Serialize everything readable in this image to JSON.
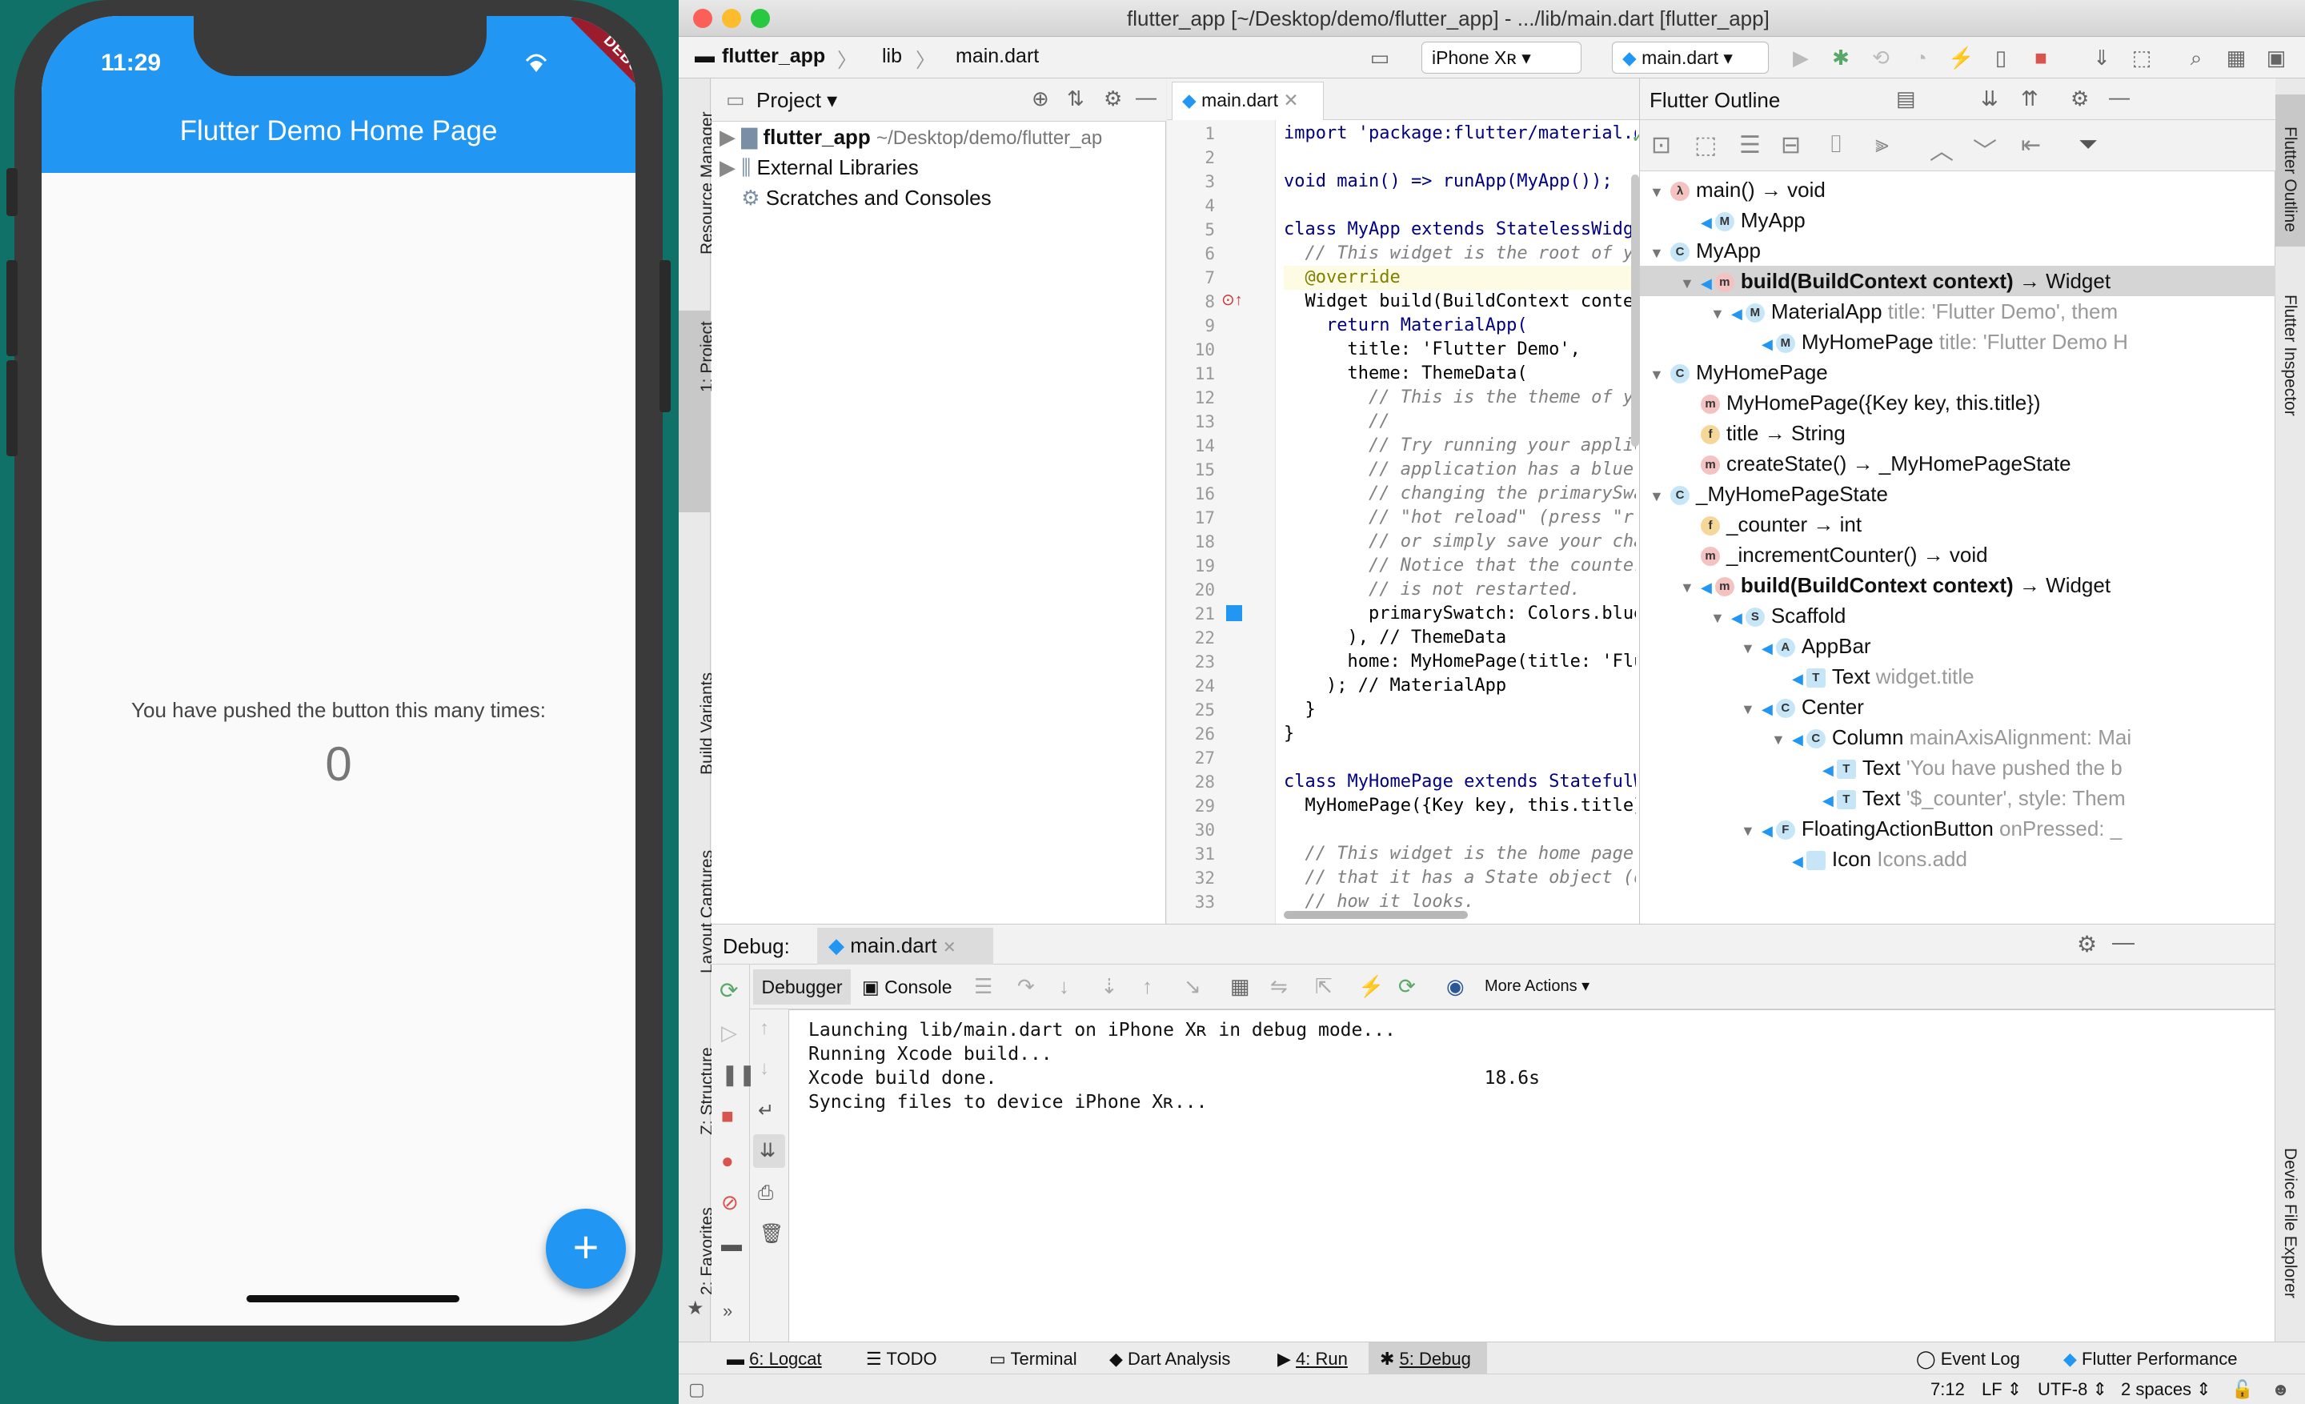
{
  "phone": {
    "time": "11:29",
    "debug_banner": "DEBUG",
    "app_title": "Flutter Demo Home Page",
    "counter_label": "You have pushed the button this many times:",
    "counter_value": "0",
    "fab_icon": "plus-icon",
    "fab_label": "+"
  },
  "window": {
    "title": "flutter_app [~/Desktop/demo/flutter_app] - .../lib/main.dart [flutter_app]"
  },
  "breadcrumbs": [
    "flutter_app",
    "lib",
    "main.dart"
  ],
  "toolbar": {
    "device": "iPhone Xʀ",
    "run_config": "main.dart"
  },
  "left_tools": [
    "Resource Manager",
    "1: Project",
    "Build Variants",
    "Layout Captures",
    "Z: Structure",
    "2: Favorites"
  ],
  "right_tools": [
    "Flutter Outline",
    "Flutter Inspector",
    "Device File Explorer"
  ],
  "project": {
    "header": "Project",
    "items": [
      {
        "label": "flutter_app",
        "path": "~/Desktop/demo/flutter_ap"
      },
      {
        "label": "External Libraries"
      },
      {
        "label": "Scratches and Consoles"
      }
    ]
  },
  "editor": {
    "tab": "main.dart",
    "lines": [
      "import 'package:flutter/material.dart';",
      "",
      "void main() => runApp(MyApp());",
      "",
      "class MyApp extends StatelessWidget {",
      "  // This widget is the root of your application.",
      "  @override",
      "  Widget build(BuildContext context) {",
      "    return MaterialApp(",
      "      title: 'Flutter Demo',",
      "      theme: ThemeData(",
      "        // This is the theme of your application.",
      "        //",
      "        // Try running your application with \"flutter run\". You'll see the",
      "        // application has a blue toolbar. Then, without quitting the app, try",
      "        // changing the primarySwatch below to Colors.green and then invoke",
      "        // \"hot reload\" (press \"r\" in the console where you ran \"flutter run\",",
      "        // or simply save your changes to \"hot reload\" in a Flutter IDE).",
      "        // Notice that the counter didn't reset back to zero; the application",
      "        // is not restarted.",
      "        primarySwatch: Colors.blue,",
      "      ), // ThemeData",
      "      home: MyHomePage(title: 'Flutter Demo Home Page'),",
      "    ); // MaterialApp",
      "  }",
      "}",
      "",
      "class MyHomePage extends StatefulWidget {",
      "  MyHomePage({Key key, this.title}) : super(key: key);",
      "",
      "  // This widget is the home page of your application. It is stateful, meaning",
      "  // that it has a State object (defined below) that contains fields that affect",
      "  // how it looks."
    ]
  },
  "outline": {
    "title": "Flutter Outline",
    "rows": [
      {
        "badge": "λ",
        "name": "main() → void",
        "extra": ""
      },
      {
        "badge": "M",
        "name": "MyApp",
        "extra": ""
      },
      {
        "badge": "C",
        "name": "MyApp",
        "extra": ""
      },
      {
        "badge": "m",
        "name": "build(BuildContext context)",
        "extra": " → Widget"
      },
      {
        "badge": "M",
        "name": "MaterialApp",
        "extra": " title: 'Flutter Demo', them"
      },
      {
        "badge": "M",
        "name": "MyHomePage",
        "extra": " title: 'Flutter Demo H"
      },
      {
        "badge": "C",
        "name": "MyHomePage",
        "extra": ""
      },
      {
        "badge": "m",
        "name": "MyHomePage({Key key, this.title})",
        "extra": ""
      },
      {
        "badge": "f",
        "name": "title → String",
        "extra": ""
      },
      {
        "badge": "m",
        "name": "createState() → _MyHomePageState",
        "extra": ""
      },
      {
        "badge": "C",
        "name": "_MyHomePageState",
        "extra": ""
      },
      {
        "badge": "f",
        "name": "_counter → int",
        "extra": ""
      },
      {
        "badge": "m",
        "name": "_incrementCounter() → void",
        "extra": ""
      },
      {
        "badge": "m",
        "name": "build(BuildContext context)",
        "extra": " → Widget"
      },
      {
        "badge": "S",
        "name": "Scaffold",
        "extra": ""
      },
      {
        "badge": "A",
        "name": "AppBar",
        "extra": ""
      },
      {
        "badge": "T",
        "name": "Text",
        "extra": " widget.title"
      },
      {
        "badge": "C",
        "name": "Center",
        "extra": ""
      },
      {
        "badge": "C",
        "name": "Column",
        "extra": " mainAxisAlignment: Mai"
      },
      {
        "badge": "T",
        "name": "Text",
        "extra": " 'You have pushed the b"
      },
      {
        "badge": "T",
        "name": "Text",
        "extra": " '$_counter', style: Them"
      },
      {
        "badge": "F",
        "name": "FloatingActionButton",
        "extra": " onPressed: _"
      },
      {
        "badge": "",
        "name": "Icon",
        "extra": " Icons.add"
      }
    ]
  },
  "debug": {
    "label": "Debug:",
    "tab": "main.dart",
    "debugger_tab": "Debugger",
    "console_tab": "Console",
    "more_actions": "More Actions",
    "console_lines": [
      "Launching lib/main.dart on iPhone Xʀ in debug mode...",
      "Running Xcode build...",
      "Xcode build done.                                            18.6s",
      "Syncing files to device iPhone Xʀ..."
    ]
  },
  "bottom_tabs": [
    "6: Logcat",
    "TODO",
    "Terminal",
    "Dart Analysis",
    "4: Run",
    "5: Debug",
    "Event Log",
    "Flutter Performance"
  ],
  "status": {
    "position": "7:12",
    "line_sep": "LF ⇕",
    "encoding": "UTF-8 ⇕",
    "indent": "2 spaces ⇕"
  }
}
